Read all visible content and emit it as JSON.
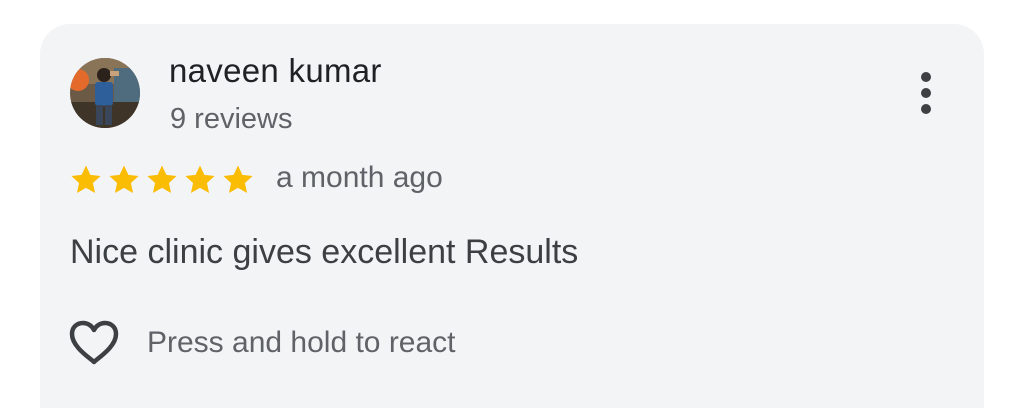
{
  "review": {
    "author": {
      "name": "naveen kumar",
      "reviews_count": "9 reviews",
      "avatar_icon": "profile-photo"
    },
    "rating": 5,
    "max_rating": 5,
    "date": "a month ago",
    "text": "Nice clinic gives excellent Results",
    "react_label": "Press and hold to react",
    "more_icon": "more-vert-icon",
    "react_icon": "heart-outline-icon"
  },
  "colors": {
    "card_background": "#f3f4f6",
    "star": "#fbbc04",
    "name_text": "#202124",
    "secondary_text": "#5f6368",
    "body_text": "#3c4043"
  }
}
